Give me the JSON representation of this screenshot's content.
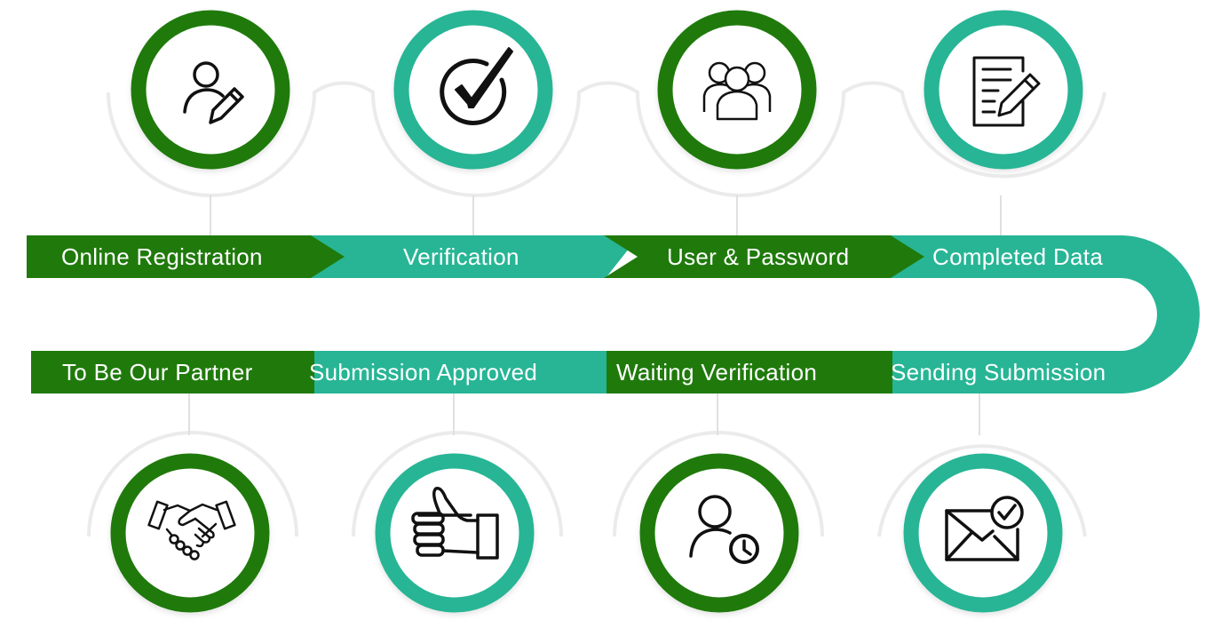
{
  "colors": {
    "dark_green": "#1f7a0b",
    "teal": "#27b595",
    "track_gray": "#e6e6e6",
    "icon_black": "#111111"
  },
  "steps_top": [
    {
      "label": "Online Registration",
      "icon": "user-edit-icon",
      "color": "dark_green"
    },
    {
      "label": "Verification",
      "icon": "check-circle-icon",
      "color": "teal"
    },
    {
      "label": "User & Password",
      "icon": "user-group-icon",
      "color": "dark_green"
    },
    {
      "label": "Completed Data",
      "icon": "document-edit-icon",
      "color": "teal"
    }
  ],
  "steps_bottom": [
    {
      "label": "To Be Our Partner",
      "icon": "handshake-icon",
      "color": "dark_green"
    },
    {
      "label": "Submission Approved",
      "icon": "thumbs-up-icon",
      "color": "teal"
    },
    {
      "label": "Waiting Verification",
      "icon": "user-clock-icon",
      "color": "dark_green"
    },
    {
      "label": "Sending Submission",
      "icon": "mail-check-icon",
      "color": "teal"
    }
  ]
}
